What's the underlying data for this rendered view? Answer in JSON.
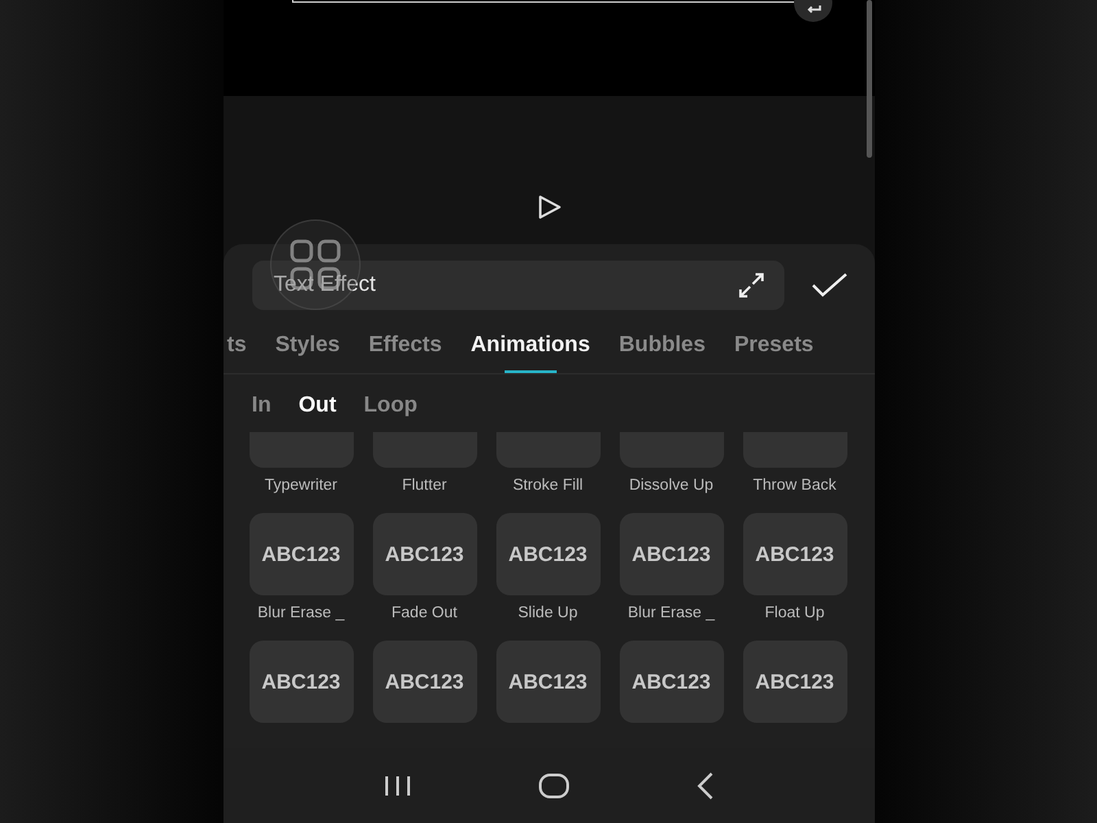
{
  "editor": {
    "value": "Text Effect"
  },
  "tabs": [
    {
      "label": "ts",
      "selected": false
    },
    {
      "label": "Styles",
      "selected": false
    },
    {
      "label": "Effects",
      "selected": false
    },
    {
      "label": "Animations",
      "selected": true
    },
    {
      "label": "Bubbles",
      "selected": false
    },
    {
      "label": "Presets",
      "selected": false
    }
  ],
  "subtabs": [
    {
      "label": "In",
      "selected": false
    },
    {
      "label": "Out",
      "selected": true
    },
    {
      "label": "Loop",
      "selected": false
    }
  ],
  "effects": [
    {
      "label": "Typewriter"
    },
    {
      "label": "Flutter"
    },
    {
      "label": "Stroke Fill"
    },
    {
      "label": "Dissolve Up"
    },
    {
      "label": "Throw Back"
    },
    {
      "sample": "ABC123",
      "label": "Blur Erase _"
    },
    {
      "sample": "ABC123",
      "label": "Fade Out"
    },
    {
      "sample": "ABC123",
      "label": "Slide Up"
    },
    {
      "sample": "ABC123",
      "label": "Blur Erase _"
    },
    {
      "sample": "ABC123",
      "label": "Float Up"
    },
    {
      "sample": "ABC123"
    },
    {
      "sample": "ABC123"
    },
    {
      "sample": "ABC123"
    },
    {
      "sample": "ABC123"
    },
    {
      "sample": "ABC123"
    }
  ]
}
